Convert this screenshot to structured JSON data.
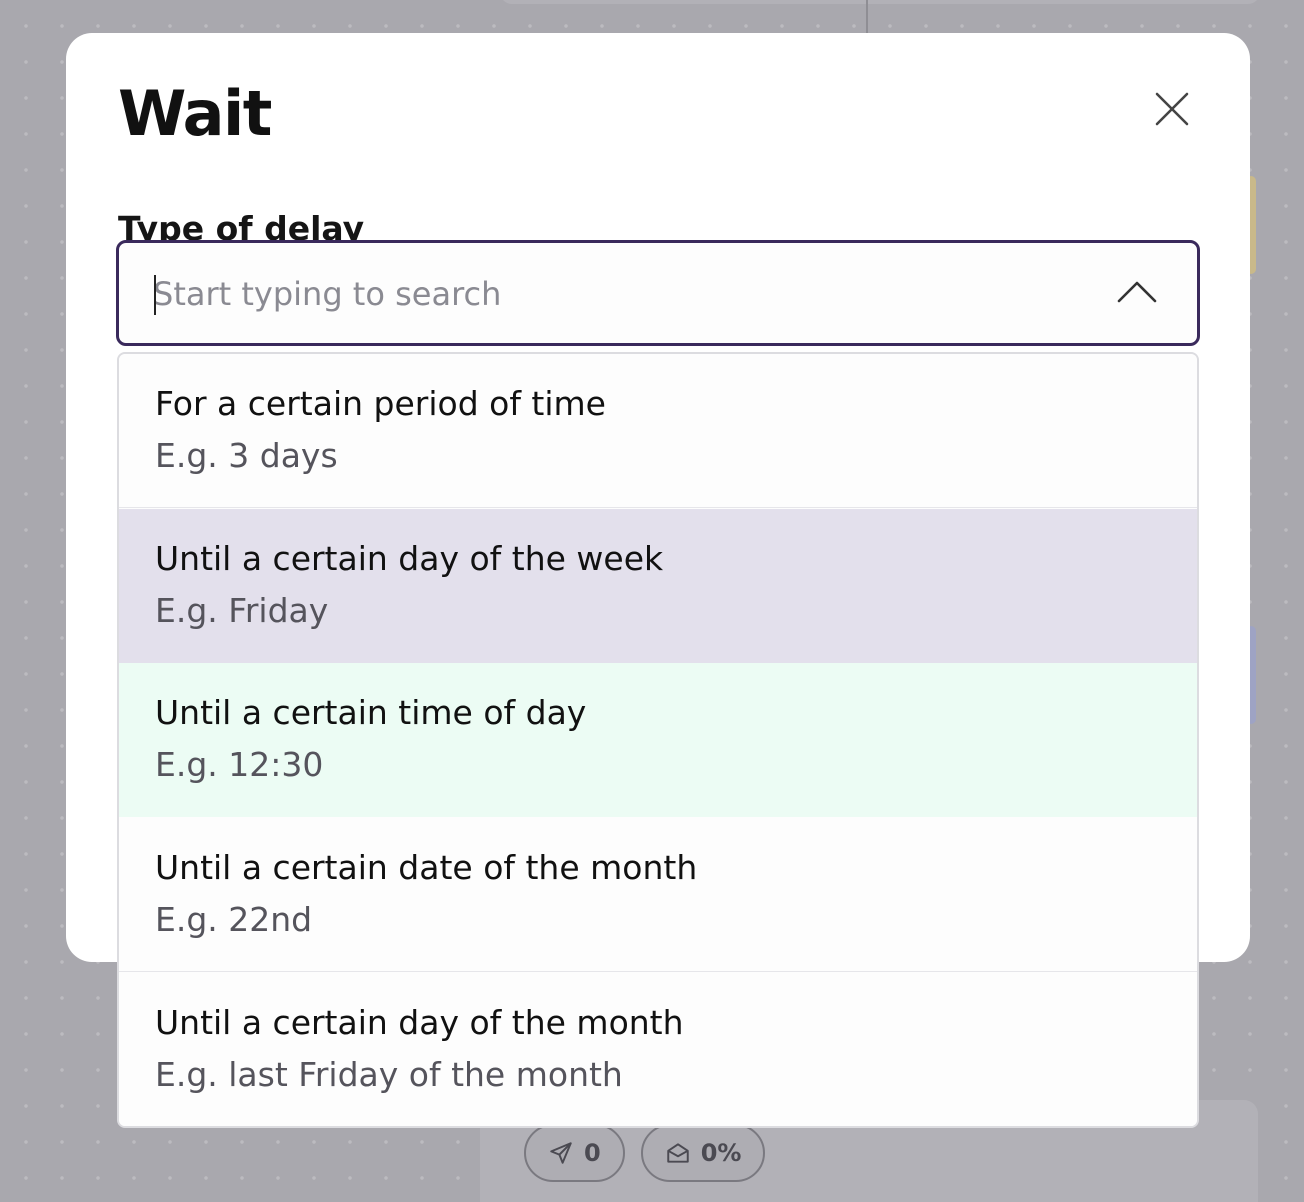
{
  "modal": {
    "title": "Wait",
    "field_label": "Type of delay",
    "search_placeholder": "Start typing to search"
  },
  "dropdown": {
    "options": [
      {
        "title": "For a certain period of time",
        "example": "E.g. 3 days",
        "state": "default"
      },
      {
        "title": "Until a certain day of the week",
        "example": "E.g. Friday",
        "state": "hovered"
      },
      {
        "title": "Until a certain time of day",
        "example": "E.g. 12:30",
        "state": "selected"
      },
      {
        "title": "Until a certain date of the month",
        "example": "E.g. 22nd",
        "state": "default"
      },
      {
        "title": "Until a certain day of the month",
        "example": "E.g. last Friday of the month",
        "state": "default"
      }
    ]
  },
  "background": {
    "sent_count": "0",
    "open_rate": "0%"
  },
  "icons": {
    "close": "close-icon",
    "chevron": "chevron-up-icon",
    "sent": "paper-plane-icon",
    "opened": "envelope-open-icon"
  },
  "colors": {
    "hover_bg": "#e3e0ec",
    "selected_bg": "#ecfcf4",
    "input_border": "#3a2a5c",
    "overlay": "#a9a8ae"
  }
}
